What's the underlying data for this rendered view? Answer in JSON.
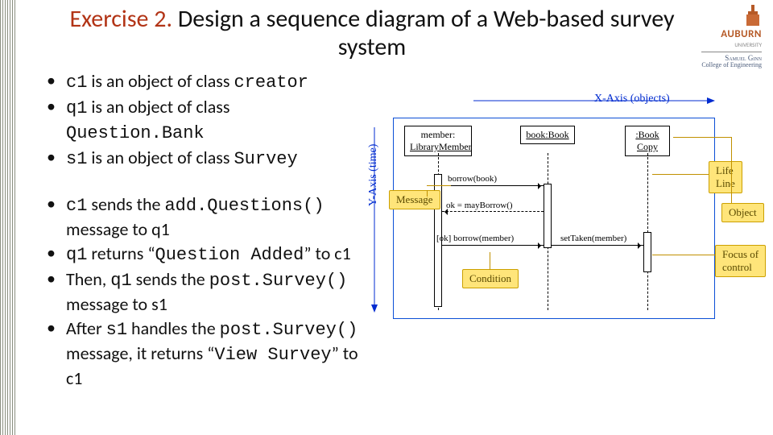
{
  "logo": {
    "univ": "AUBURN",
    "sub": "UNIVERSITY",
    "school1": "Samuel Ginn",
    "school2": "College of Engineering"
  },
  "title": {
    "prefix": "Exercise 2.",
    "rest": " Design a sequence diagram of a Web-based survey system"
  },
  "bullets": {
    "b1a": "c1",
    "b1b": " is an object of class ",
    "b1c": "creator",
    "b2a": "q1",
    "b2b": " is an object of class ",
    "b2c": "Question.Bank",
    "b3a": "s1",
    "b3b": " is an object of class ",
    "b3c": "Survey",
    "b4a": "c1",
    "b4b": " sends the ",
    "b4c": "add.Questions()",
    "b4d": " message to q1",
    "b5a": "q1",
    "b5b": " returns “",
    "b5c": "Question Added",
    "b5d": "” to c1",
    "b6a": "Then, ",
    "b6b": "q1",
    "b6c": " sends the ",
    "b6d": "post.Survey()",
    "b6e": " message to s1",
    "b7a": "After ",
    "b7b": "s1",
    "b7c": " handles the ",
    "b7d": "post.Survey()",
    "b7e": " message, it returns “",
    "b7f": "View Survey",
    "b7g": "” to c1"
  },
  "diagram": {
    "xaxis": "X-Axis (objects)",
    "yaxis": "Y-Axis (time)",
    "obj1a": "member:",
    "obj1b": "LibraryMember",
    "obj2": "book:Book",
    "obj3a": ":Book",
    "obj3b": "Copy",
    "msg1": "borrow(book)",
    "msg2": "ok = mayBorrow()",
    "msg3": "[ok] borrow(member)",
    "msg4": "setTaken(member)",
    "call_msg": "Message",
    "call_cond": "Condition",
    "call_life1": "Life",
    "call_life2": "Line",
    "call_obj": "Object",
    "call_foc1": "Focus of",
    "call_foc2": "control"
  }
}
